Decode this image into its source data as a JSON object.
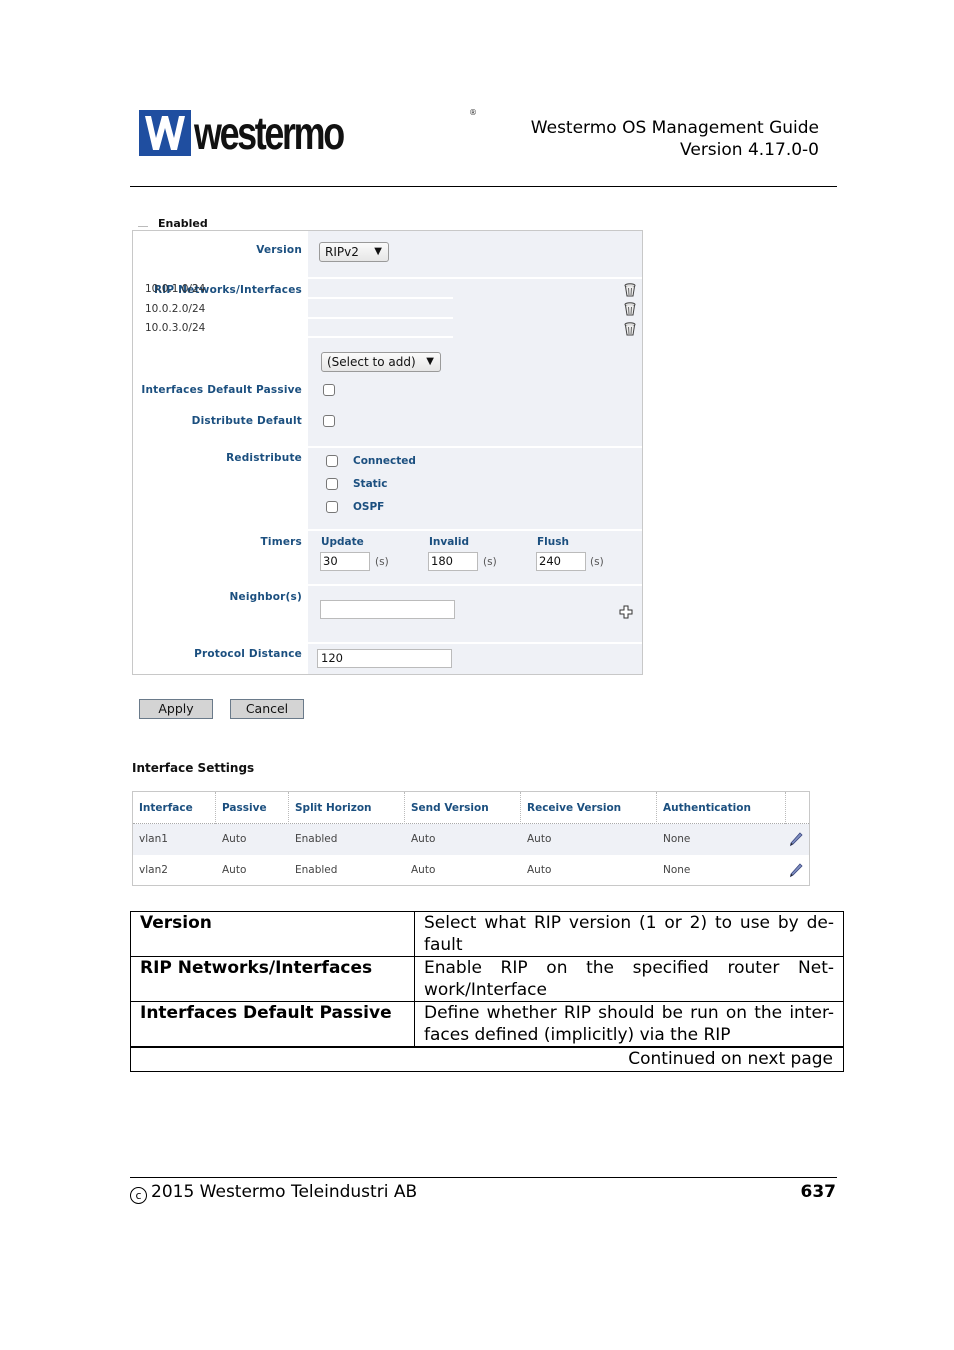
{
  "header": {
    "logo_text": "westermo",
    "logo_reg": "®",
    "doc_title": "Westermo OS Management Guide",
    "doc_version": "Version 4.17.0-0"
  },
  "form": {
    "cut_label": "Enabled",
    "version": {
      "label": "Version",
      "value": "RIPv2"
    },
    "networks": {
      "label": "RIP Networks/Interfaces",
      "items": [
        "10.0.1.0/24",
        "10.0.2.0/24",
        "10.0.3.0/24"
      ],
      "add_select": "(Select to add)"
    },
    "interfaces_default_passive": {
      "label": "Interfaces Default Passive",
      "checked": false
    },
    "distribute_default": {
      "label": "Distribute Default",
      "checked": false
    },
    "redistribute": {
      "label": "Redistribute",
      "options": [
        {
          "label": "Connected",
          "checked": false
        },
        {
          "label": "Static",
          "checked": false
        },
        {
          "label": "OSPF",
          "checked": false
        }
      ]
    },
    "timers": {
      "label": "Timers",
      "update": {
        "label": "Update",
        "value": "30",
        "unit": "(s)"
      },
      "invalid": {
        "label": "Invalid",
        "value": "180",
        "unit": "(s)"
      },
      "flush": {
        "label": "Flush",
        "value": "240",
        "unit": "(s)"
      }
    },
    "neighbors": {
      "label": "Neighbor(s)",
      "value": ""
    },
    "protocol_distance": {
      "label": "Protocol Distance",
      "value": "120"
    }
  },
  "buttons": {
    "apply": "Apply",
    "cancel": "Cancel"
  },
  "interface_settings": {
    "title": "Interface Settings",
    "columns": [
      "Interface",
      "Passive",
      "Split Horizon",
      "Send Version",
      "Receive Version",
      "Authentication"
    ],
    "rows": [
      [
        "vlan1",
        "Auto",
        "Enabled",
        "Auto",
        "Auto",
        "None"
      ],
      [
        "vlan2",
        "Auto",
        "Enabled",
        "Auto",
        "Auto",
        "None"
      ]
    ]
  },
  "description_table": {
    "rows": [
      {
        "term": "Version",
        "definition": "Select what RIP version (1 or 2) to use by de- fault"
      },
      {
        "term": "RIP Networks/Interfaces",
        "definition": "Enable RIP on the specified router Net- work/Interface"
      },
      {
        "term": "Interfaces Default Passive",
        "definition": "Define whether RIP should be run on the inter- faces defined (implicitly) via the RIP"
      }
    ],
    "continued": "Continued on next page"
  },
  "footer": {
    "copyright_symbol": "c",
    "copyright_text": "2015 Westermo Teleindustri AB",
    "page_number": "637"
  }
}
